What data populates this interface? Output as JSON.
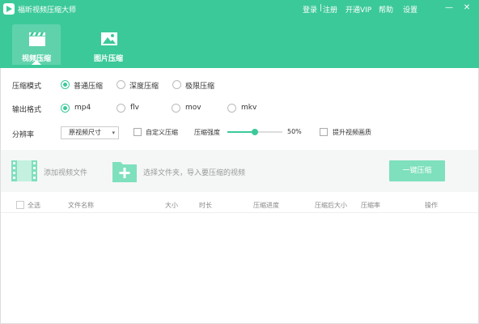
{
  "app": {
    "title": "福昕视频压缩大师"
  },
  "top_links": {
    "login": "登录",
    "separator": "|",
    "register": "注册",
    "vip": "开通VIP",
    "help": "帮助",
    "settings": "设置"
  },
  "window_controls": {
    "minimize": "—",
    "close": "✕"
  },
  "nav": [
    {
      "label": "视频压缩",
      "icon": "clapperboard-icon",
      "active": true
    },
    {
      "label": "图片压缩",
      "icon": "image-icon",
      "active": false
    }
  ],
  "compress_mode": {
    "label": "压缩模式",
    "options": [
      "普通压缩",
      "深度压缩",
      "极限压缩"
    ],
    "selected": "普通压缩"
  },
  "output_format": {
    "label": "输出格式",
    "options": [
      "mp4",
      "flv",
      "mov",
      "mkv"
    ],
    "selected": "mp4"
  },
  "resolution": {
    "label": "分辨率",
    "value": "原视频尺寸",
    "custom_label": "自定义压缩",
    "custom_checked": false,
    "strength_label": "压缩强度",
    "strength_value": 0.5,
    "strength_text": "50%",
    "enhance_label": "提升视频画质",
    "enhance_checked": false
  },
  "actions": {
    "add_video": "添加视频文件",
    "add_folder": "选择文件夹，导入要压缩的视频",
    "compress_all": "一键压缩"
  },
  "table": {
    "select_all": "全选",
    "columns": [
      "文件名称",
      "大小",
      "时长",
      "压缩进度",
      "压缩后大小",
      "压缩率",
      "操作"
    ]
  },
  "colors": {
    "brand": "#3cc99a",
    "button_disabled": "#7ee0bd"
  }
}
